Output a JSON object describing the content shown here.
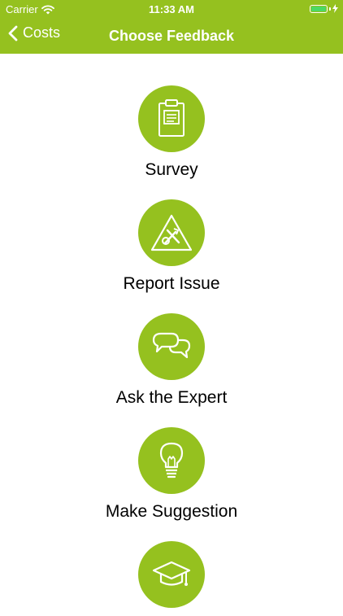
{
  "status_bar": {
    "carrier": "Carrier",
    "time": "11:33 AM"
  },
  "nav": {
    "back_label": "Costs",
    "title": "Choose Feedback"
  },
  "options": [
    {
      "label": "Survey",
      "icon": "clipboard-icon"
    },
    {
      "label": "Report Issue",
      "icon": "warning-tools-icon"
    },
    {
      "label": "Ask the Expert",
      "icon": "chat-bubbles-icon"
    },
    {
      "label": "Make Suggestion",
      "icon": "lightbulb-icon"
    },
    {
      "label": "",
      "icon": "graduation-cap-icon"
    }
  ],
  "colors": {
    "accent": "#95c11f",
    "battery": "#4cd964"
  }
}
